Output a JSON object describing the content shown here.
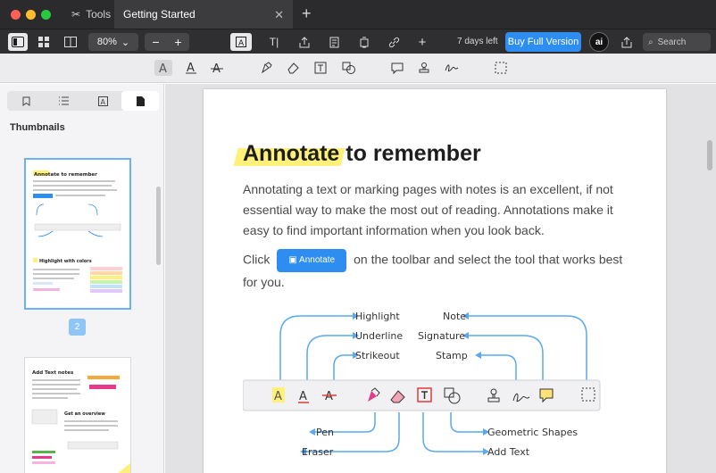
{
  "titlebar": {
    "tools_tab": "Tools",
    "active_tab": "Getting Started",
    "close_glyph": "✕",
    "new_tab_glyph": "+"
  },
  "toolbar": {
    "zoom": "80%",
    "zoom_out": "−",
    "zoom_in": "+",
    "text_tool": "T|",
    "add": "+",
    "days_left": "7 days left",
    "buy_button": "Buy Full Version",
    "ai_label": "ai",
    "search_placeholder": "Search"
  },
  "annotation_bar": {
    "icons": [
      "highlight-icon",
      "underline-icon",
      "strikeout-icon",
      "pen-icon",
      "eraser-icon",
      "textbox-icon",
      "shapes-icon",
      "note-icon",
      "stamp-icon",
      "signature-icon",
      "selection-icon"
    ]
  },
  "sidebar": {
    "tabs": [
      "bookmark-icon",
      "outline-icon",
      "annotations-icon",
      "thumbnails-icon"
    ],
    "heading": "Thumbnails",
    "current_page": "2"
  },
  "document": {
    "title_highlight": "Annotate",
    "title_rest": " to remember",
    "paragraph1": "Annotating a text or marking pages with notes is an excellent, if not essential way to make the most out of reading. Annotations make it easy to find important information when you look back.",
    "paragraph2_before": "Click",
    "annotate_button": "Annotate",
    "paragraph2_after": "on the toolbar and select the tool that works best for you.",
    "diagram": {
      "labels": [
        "Highlight",
        "Underline",
        "Strikeout",
        "Note",
        "Signature",
        "Stamp",
        "Pen",
        "Eraser",
        "Geometric Shapes",
        "Add Text"
      ]
    }
  },
  "thumbnails": {
    "page1_heading": "Annotate to remember",
    "page1_sub": "Highlight with colors",
    "page2_heading": "Add Text notes",
    "page2_sub": "Get an overview"
  },
  "colors": {
    "accent": "#2e8df0",
    "highlight": "#fff07a",
    "titlebar": "#2b2b2d"
  }
}
